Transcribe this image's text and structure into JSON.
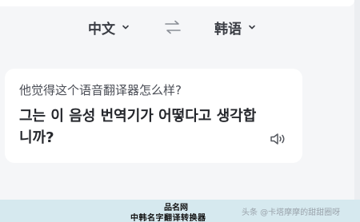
{
  "languages": {
    "source_label": "中文",
    "target_label": "韩语"
  },
  "card": {
    "question": "他觉得这个语音翻译器怎么样?",
    "answer": "그는 이 음성 번역기가 어떻다고 생각합니까?"
  },
  "stamp": {
    "line1": "品名网",
    "line2": "中韩名字翻译转换器"
  },
  "watermark": "头条 @卡塔摩摩的甜甜圈呀",
  "icons": {
    "swap": "swap-arrows-icon",
    "speaker": "speaker-icon",
    "chevron": "chevron-down-icon"
  },
  "colors": {
    "background": "#f5f6f8",
    "card": "#ffffff",
    "bottom_band": "#d6e9ef"
  }
}
